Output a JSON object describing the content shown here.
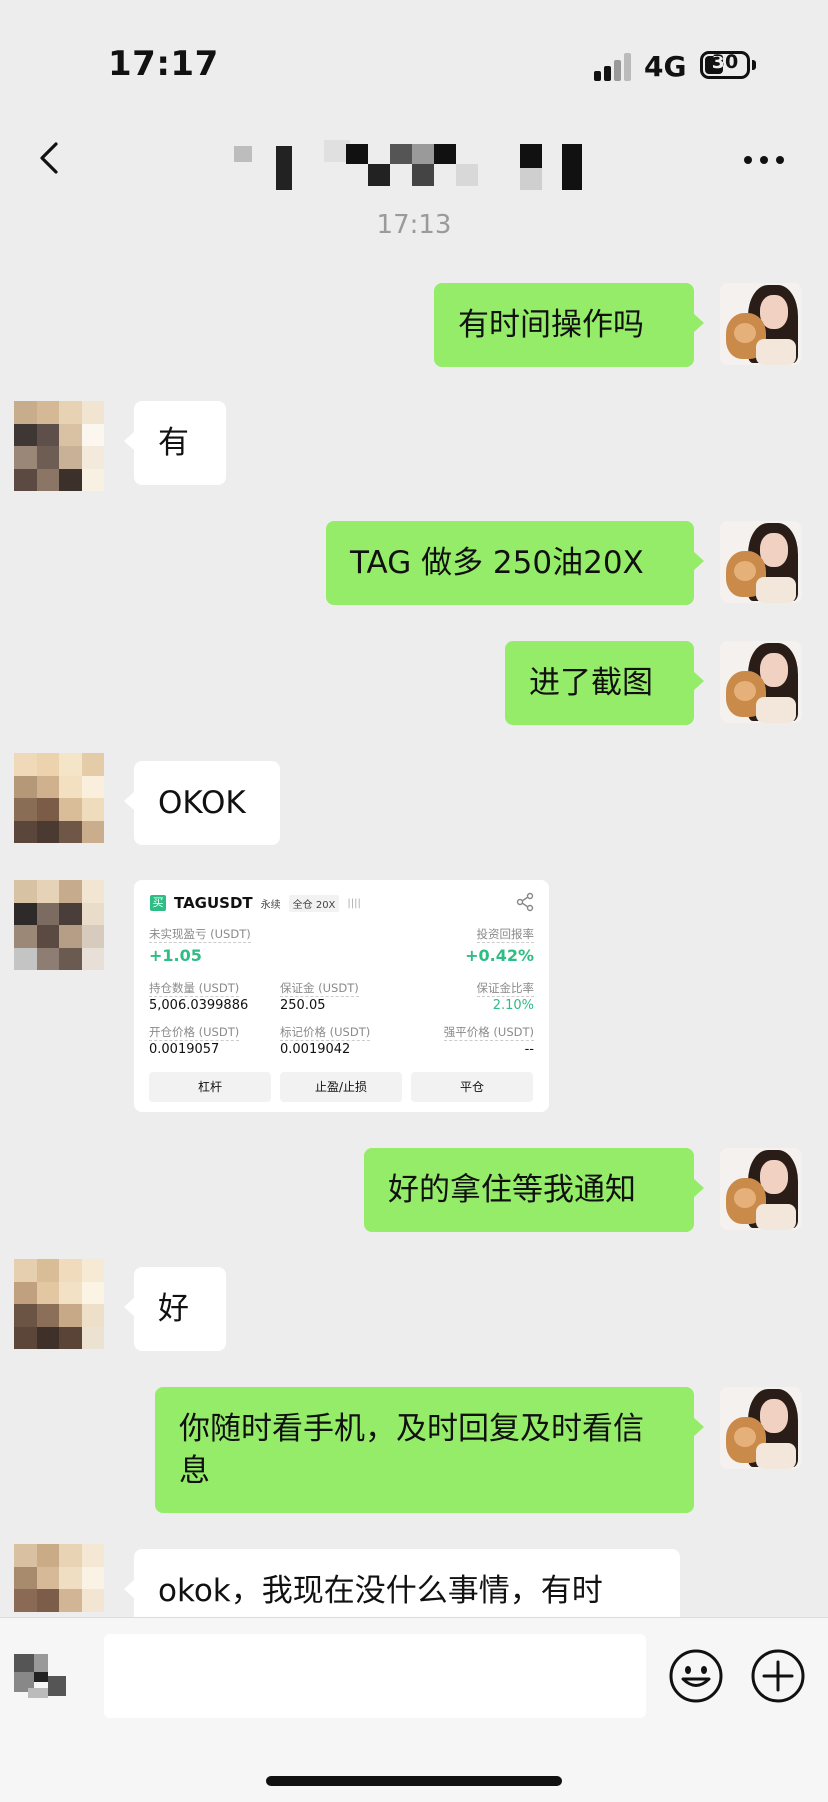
{
  "status": {
    "time": "17:17",
    "network": "4G",
    "battery": "30"
  },
  "chat": {
    "timestamp": "17:13",
    "messages": [
      {
        "from": "me",
        "text": "有时间操作吗"
      },
      {
        "from": "other",
        "text": "有"
      },
      {
        "from": "me",
        "text": "TAG 做多 250油20X"
      },
      {
        "from": "me",
        "text": "进了截图"
      },
      {
        "from": "other",
        "text": "OKOK"
      },
      {
        "from": "me",
        "text": "好的拿住等我通知"
      },
      {
        "from": "other",
        "text": "好"
      },
      {
        "from": "me",
        "text": "你随时看手机，及时回复及时看信息"
      },
      {
        "from": "other",
        "text": "okok，我现在没什么事情，有时"
      }
    ]
  },
  "trade_card": {
    "side": "买",
    "symbol": "TAGUSDT",
    "type": "永续",
    "margin_mode": "全仓 20X",
    "bars": "||||",
    "unrealized_label": "未实现盈亏 (USDT)",
    "unrealized_value": "+1.05",
    "roi_label": "投资回报率",
    "roi_value": "+0.42%",
    "position_label": "持仓数量 (USDT)",
    "position_value": "5,006.0399886",
    "margin_label": "保证金 (USDT)",
    "margin_value": "250.05",
    "margin_ratio_label": "保证金比率",
    "margin_ratio_value": "2.10%",
    "entry_label": "开仓价格 (USDT)",
    "entry_value": "0.0019057",
    "mark_label": "标记价格 (USDT)",
    "mark_value": "0.0019042",
    "liq_label": "强平价格 (USDT)",
    "liq_value": "--",
    "btn_leverage": "杠杆",
    "btn_tpsl": "止盈/止损",
    "btn_close": "平仓"
  },
  "icons": {
    "back": "chevron-left-icon",
    "more": "more-dots-icon",
    "emoji": "emoji-icon",
    "plus": "plus-circle-icon",
    "share": "share-icon"
  },
  "colors": {
    "bubble_me": "#95ec69",
    "bubble_other": "#ffffff",
    "background": "#ededed",
    "profit": "#2ebd85"
  }
}
